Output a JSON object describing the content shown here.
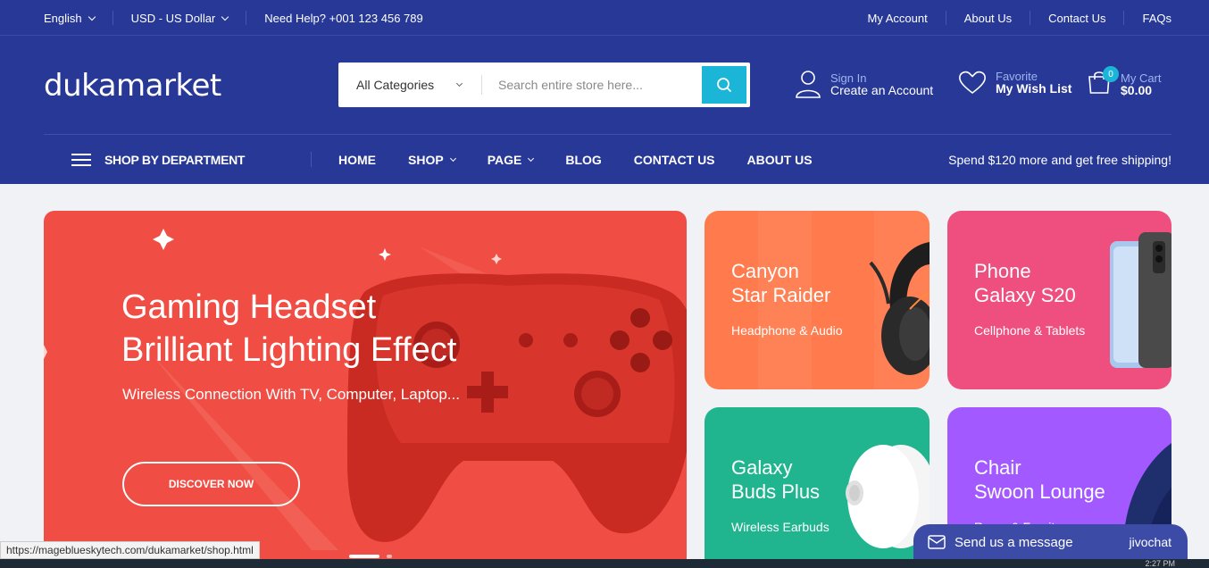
{
  "topbar": {
    "language": "English",
    "currency": "USD - US Dollar",
    "help": "Need Help? +001 123 456 789",
    "links": [
      "My Account",
      "About Us",
      "Contact Us",
      "FAQs"
    ]
  },
  "header": {
    "logo": "dukamarket",
    "category": "All Categories",
    "search_placeholder": "Search entire store here...",
    "signin_small": "Sign In",
    "signin_big": "Create an Account",
    "wish_small": "Favorite",
    "wish_big": "My Wish List",
    "cart_count": "0",
    "cart_small": "My Cart",
    "cart_big": "$0.00"
  },
  "nav": {
    "department": "SHOP BY DEPARTMENT",
    "items": [
      "HOME",
      "SHOP",
      "PAGE",
      "BLOG",
      "CONTACT US",
      "ABOUT US"
    ],
    "shipping": "Spend $120 more and get free shipping!"
  },
  "hero": {
    "title1": "Gaming Headset",
    "title2": "Brilliant Lighting Effect",
    "subtitle": "Wireless Connection With TV, Computer, Laptop...",
    "button": "DISCOVER NOW"
  },
  "cards": [
    {
      "t1": "Canyon",
      "t2": "Star Raider",
      "sub": "Headphone & Audio",
      "color": "#ff7a4d"
    },
    {
      "t1": "Phone",
      "t2": "Galaxy S20",
      "sub": "Cellphone & Tablets",
      "color": "#ee4f7f"
    },
    {
      "t1": "Galaxy",
      "t2": "Buds Plus",
      "sub": "Wireless Earbuds",
      "color": "#21b58f"
    },
    {
      "t1": "Chair",
      "t2": "Swoon Lounge",
      "sub": "Room & Furniture",
      "color": "#a259ff"
    }
  ],
  "status_url": "https://mageblueskytech.com/dukamarket/shop.html",
  "chat": {
    "label": "Send us a message",
    "brand": "jivochat"
  },
  "clock": "2:27 PM",
  "colors": {
    "primary": "#273896",
    "accent": "#1bb5d8",
    "hero": "#f04e45"
  }
}
